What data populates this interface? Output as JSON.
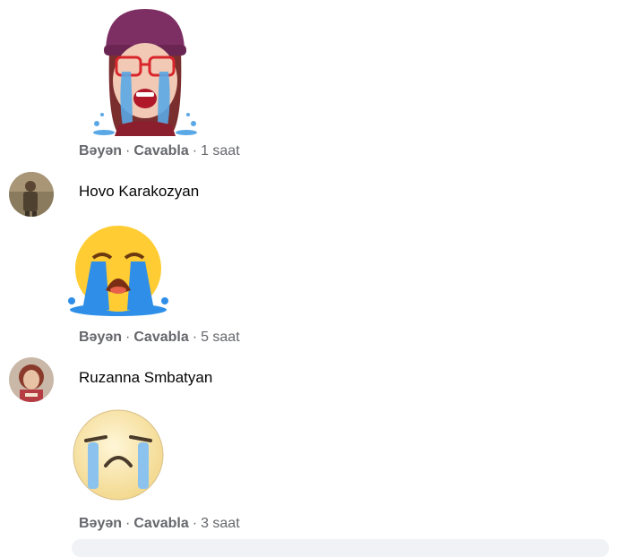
{
  "comments": [
    {
      "author": "",
      "sticker": "memoji-crying-girl-sticker",
      "actions": {
        "like": "Bəyən",
        "reply": "Cavabla",
        "time": "1 saat"
      }
    },
    {
      "author": "Hovo Karakozyan",
      "sticker": "loudly-crying-face-emoji",
      "actions": {
        "like": "Bəyən",
        "reply": "Cavabla",
        "time": "5 saat"
      }
    },
    {
      "author": "Ruzanna Smbatyan",
      "sticker": "crying-face-emoji",
      "actions": {
        "like": "Bəyən",
        "reply": "Cavabla",
        "time": "3 saat"
      }
    }
  ],
  "separator": "·",
  "colors": {
    "meta_text": "#65676b",
    "name_text": "#050505",
    "input_bg": "#f0f2f5"
  }
}
